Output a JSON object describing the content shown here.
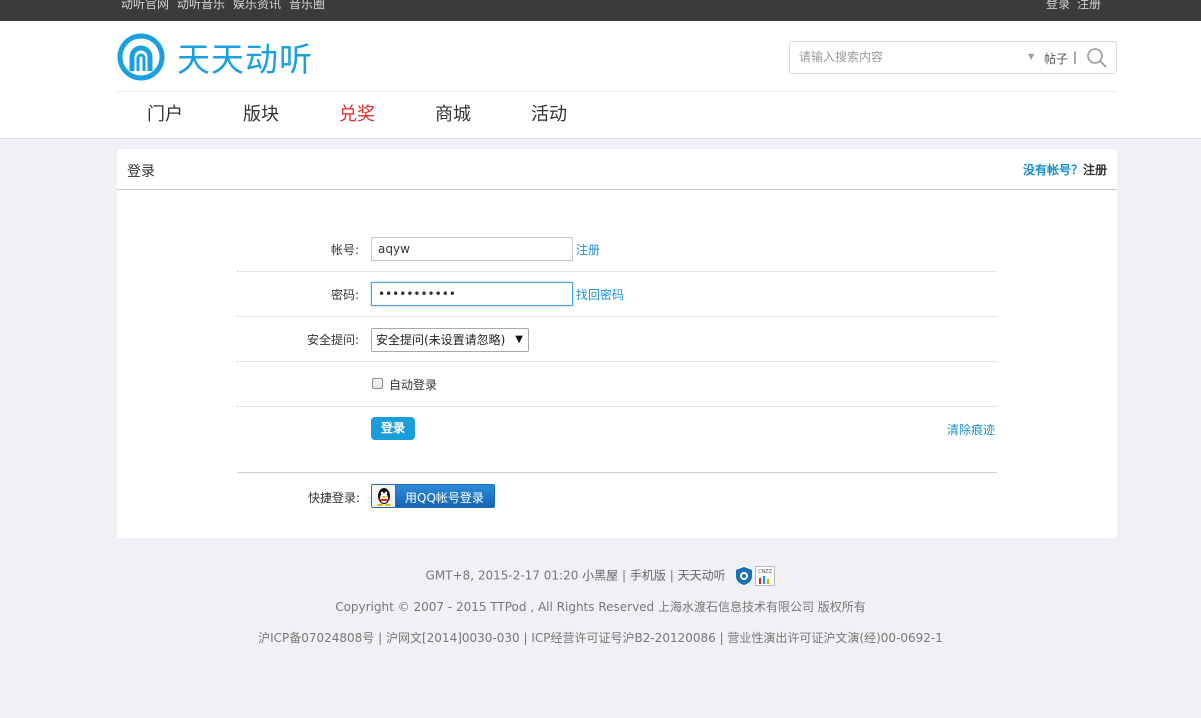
{
  "topbar": {
    "links": [
      "动听官网",
      "动听音乐",
      "娱乐资讯",
      "音乐圈"
    ],
    "login": "登录",
    "register": "注册"
  },
  "logo": {
    "text": "天天动听",
    "color": "#1aa0e0"
  },
  "search": {
    "placeholder": "请输入搜索内容",
    "type": "帖子",
    "separator": "|",
    "icon": "search-icon"
  },
  "nav": {
    "items": [
      {
        "label": "门户",
        "active": false
      },
      {
        "label": "版块",
        "active": false
      },
      {
        "label": "兑奖",
        "active": true
      },
      {
        "label": "商城",
        "active": false
      },
      {
        "label": "活动",
        "active": false
      }
    ],
    "active_color": "#e02d2d"
  },
  "panel": {
    "title": "登录",
    "no_account": "没有帐号？",
    "register": "注册"
  },
  "form": {
    "account_label": "帐号:",
    "account_value": "aqyw",
    "account_link": "注册",
    "password_label": "密码:",
    "password_value": "•••••••••••",
    "password_link": "找回密码",
    "question_label": "安全提问:",
    "question_value": "安全提问(未设置请忽略)",
    "auto_login": "自动登录",
    "login_button": "登录",
    "clear_link": "清除痕迹",
    "quick_label": "快捷登录:",
    "qq_button": "用QQ帐号登录"
  },
  "footer": {
    "line1_time": "GMT+8, 2015-2-17 01:20",
    "line1_links": [
      "小黑屋",
      "手机版",
      "天天动听"
    ],
    "line2": "Copyright © 2007 - 2015 TTPod , All Rights Reserved 上海水渡石信息技术有限公司 版权所有",
    "line3": "沪ICP备07024808号 | 沪网文[2014]0030-030 | ICP经营许可证号沪B2-20120086 | 营业性演出许可证沪文演(经)00-0692-1",
    "cnzz": "CNZZ"
  },
  "colors": {
    "accent": "#1a9ed9",
    "link": "#1a8fd0"
  }
}
